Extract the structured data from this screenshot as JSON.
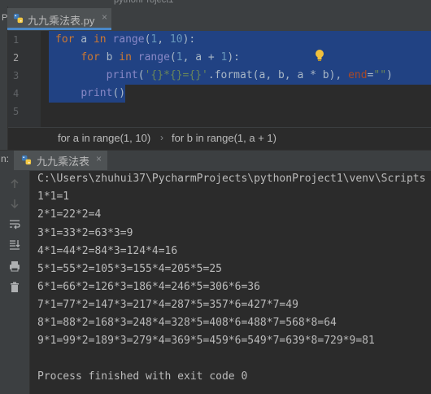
{
  "top_fragment": "pythonProject1",
  "left_peek_label": "P",
  "editor": {
    "tab_title": "九九乘法表.py",
    "line_numbers": [
      "1",
      "2",
      "3",
      "4",
      "5"
    ]
  },
  "breadcrumbs": [
    "for a in range(1, 10)",
    "for b in range(1, a + 1)"
  ],
  "breadcrumb_sep": "›",
  "run": {
    "label": "n:",
    "tab_title": "九九乘法表",
    "close": "×"
  },
  "console": {
    "lines": [
      "C:\\Users\\zhuhui37\\PycharmProjects\\pythonProject1\\venv\\Scripts",
      "1*1=1",
      "2*1=22*2=4",
      "3*1=33*2=63*3=9",
      "4*1=44*2=84*3=124*4=16",
      "5*1=55*2=105*3=155*4=205*5=25",
      "6*1=66*2=126*3=186*4=246*5=306*6=36",
      "7*1=77*2=147*3=217*4=287*5=357*6=427*7=49",
      "8*1=88*2=168*3=248*4=328*5=408*6=488*7=568*8=64",
      "9*1=99*2=189*3=279*4=369*5=459*6=549*7=639*8=729*9=81",
      "",
      "Process finished with exit code 0"
    ]
  },
  "icons": {
    "editor_tab": "python-file-icon",
    "run_tab": "python-file-icon",
    "toolbar": [
      "arrow-up-icon",
      "arrow-down-icon",
      "soft-wrap-icon",
      "scroll-to-end-icon",
      "print-icon",
      "trash-icon"
    ],
    "intention": "lightbulb-icon"
  },
  "colors": {
    "selection": "#214283",
    "keyword": "#cc7832",
    "builtin": "#8888c6",
    "number": "#6897bb",
    "string": "#6a8759",
    "param": "#aa4926",
    "tab_underline": "#4a88c7"
  }
}
